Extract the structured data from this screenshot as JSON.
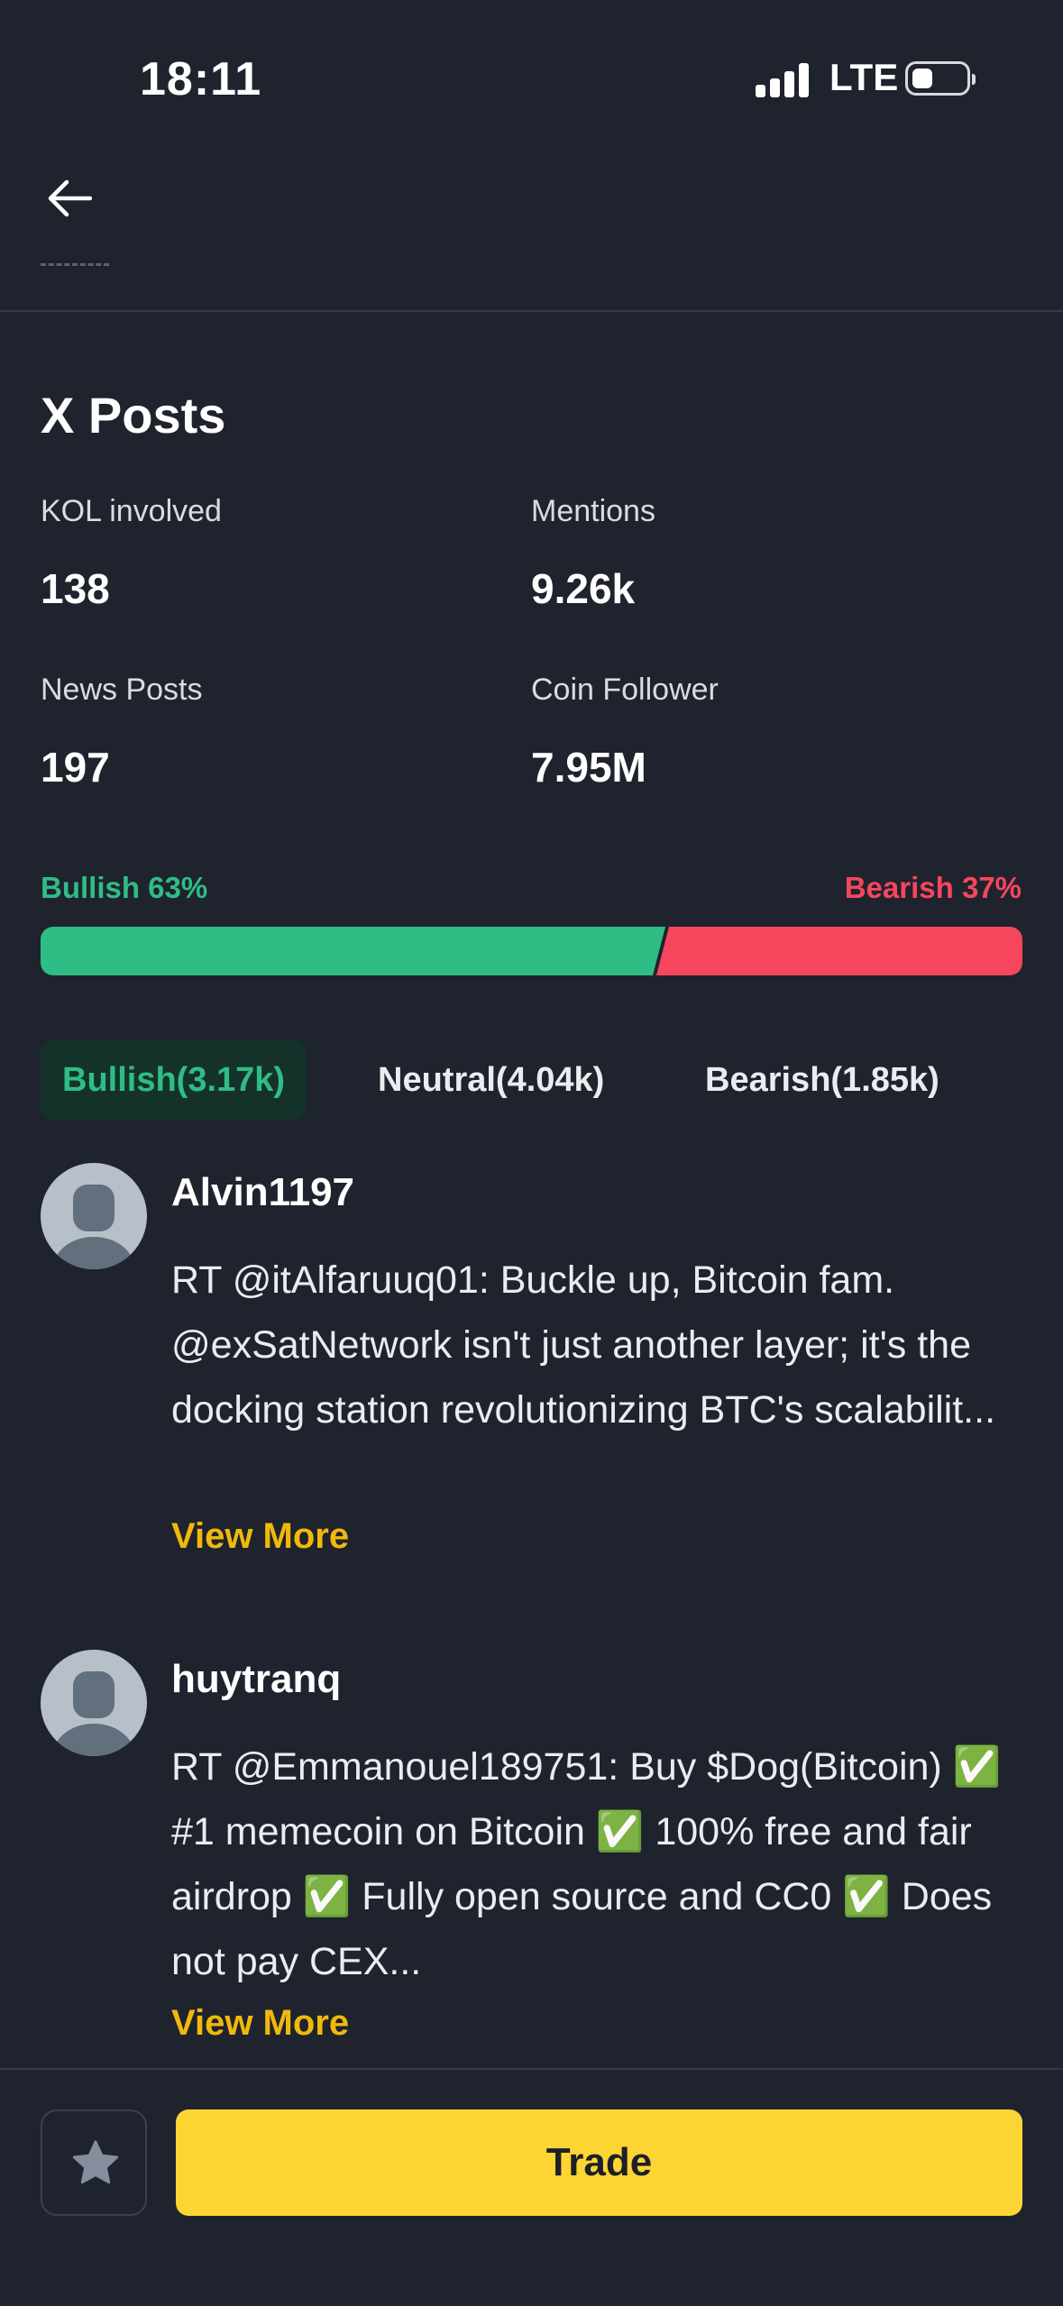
{
  "status_bar": {
    "time": "18:11",
    "network": "LTE"
  },
  "section": {
    "title": "X Posts"
  },
  "stats": [
    {
      "label": "KOL involved",
      "value": "138"
    },
    {
      "label": "Mentions",
      "value": "9.26k"
    },
    {
      "label": "News Posts",
      "value": "197"
    },
    {
      "label": "Coin Follower",
      "value": "7.95M"
    }
  ],
  "sentiment": {
    "bullish_label": "Bullish 63%",
    "bearish_label": "Bearish 37%",
    "bullish_percent": 63,
    "bearish_percent": 37,
    "bullish_color": "#2ebd85",
    "bearish_color": "#f6465d"
  },
  "tabs": [
    {
      "label": "Bullish(3.17k)",
      "active": true
    },
    {
      "label": "Neutral(4.04k)",
      "active": false
    },
    {
      "label": "Bearish(1.85k)",
      "active": false
    }
  ],
  "posts": [
    {
      "username": "Alvin1197",
      "text": "RT @itAlfaruuq01: Buckle up, Bitcoin fam. @exSatNetwork isn't just another layer; it's the docking station revolutionizing BTC's scalabilit...",
      "view_more": "View More"
    },
    {
      "username": "huytranq",
      "text": "RT @Emmanouel189751: Buy $Dog(Bitcoin) ✅ #1 memecoin on Bitcoin ✅ 100% free and fair airdrop ✅ Fully open source and CC0 ✅ Does not pay CEX...",
      "view_more": "View More"
    }
  ],
  "bottom": {
    "trade_label": "Trade",
    "accent": "#fcd535"
  }
}
